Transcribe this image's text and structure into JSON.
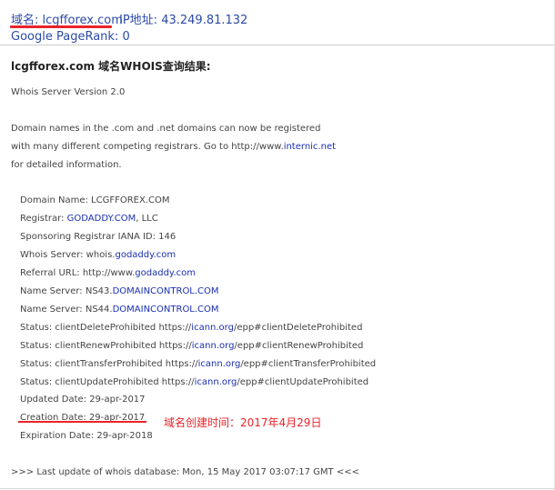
{
  "header": {
    "domain_label": "域名:",
    "domain_value": "lcgfforex.com",
    "ip_label": "IP地址:",
    "ip_value": "43.249.81.132",
    "pagerank": "Google PageRank: 0"
  },
  "title": "lcgfforex.com 域名WHOIS查询结果:",
  "server_version": "Whois Server Version 2.0",
  "intro": {
    "line1": "Domain names in the .com and .net domains can now be registered",
    "line2_prefix": "with many different competing registrars. Go to http://www.",
    "line2_link": "internic.net",
    "line3": "for detailed information."
  },
  "records": {
    "domain_name": "Domain Name: LCGFFOREX.COM",
    "registrar_prefix": "Registrar: ",
    "registrar_link": "GODADDY.COM",
    "registrar_suffix": ", LLC",
    "iana": "Sponsoring Registrar IANA ID: 146",
    "whois_prefix": "Whois Server: whois.",
    "whois_link": "godaddy.com",
    "referral_prefix": "Referral URL: http://www.",
    "referral_link": "godaddy.com",
    "ns1_prefix": "Name Server: NS43.",
    "ns1_link": "DOMAINCONTROL.COM",
    "ns2_prefix": "Name Server: NS44.",
    "ns2_link": "DOMAINCONTROL.COM",
    "status1_prefix": "Status: clientDeleteProhibited https://",
    "status1_link": "icann.org",
    "status1_suffix": "/epp#clientDeleteProhibited",
    "status2_prefix": "Status: clientRenewProhibited https://",
    "status2_link": "icann.org",
    "status2_suffix": "/epp#clientRenewProhibited",
    "status3_prefix": "Status: clientTransferProhibited https://",
    "status3_link": "icann.org",
    "status3_suffix": "/epp#clientTransferProhibited",
    "status4_prefix": "Status: clientUpdateProhibited https://",
    "status4_link": "icann.org",
    "status4_suffix": "/epp#clientUpdateProhibited",
    "updated": "Updated Date: 29-apr-2017",
    "creation": "Creation Date: 29-apr-2017",
    "expiration": "Expiration Date: 29-apr-2018"
  },
  "annotation": "域名创建时间：2017年4月29日",
  "footer": ">>> Last update of whois database: Mon, 15 May 2017 03:07:17 GMT <<<",
  "colors": {
    "accent_red": "#e8242a",
    "link_blue": "#1a2fb0",
    "label_blue": "#2b4aa6"
  }
}
